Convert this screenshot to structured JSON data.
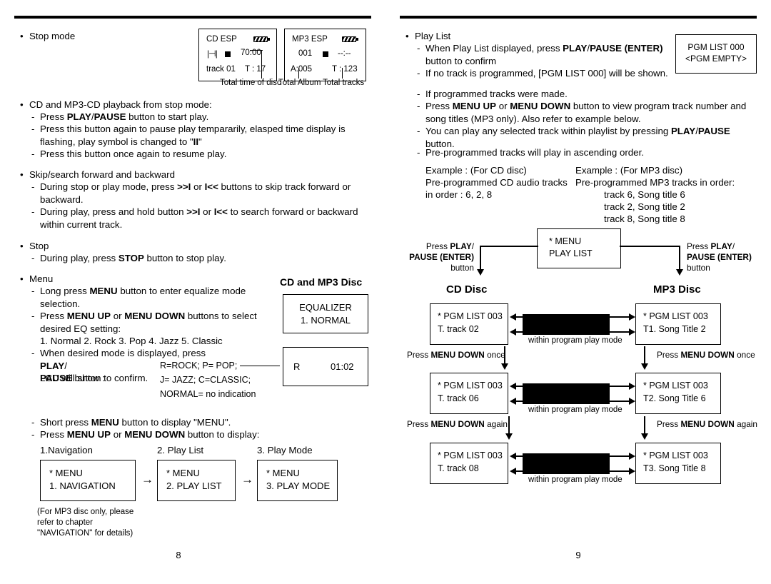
{
  "document": {
    "type": "portable-cd-mp3-player-user-manual-spread",
    "left_page_number": "8",
    "right_page_number": "9"
  },
  "left_page": {
    "stop_mode": {
      "heading": "Stop mode",
      "lcd_cd": {
        "title": "CD ESP",
        "battery_icon": "battery-icon",
        "disc_icon": "disc-icon",
        "stop_icon": "stop-square-icon",
        "time": "70:00",
        "track_label": "track 01",
        "total": "T : 17"
      },
      "lcd_mp3": {
        "title": "MP3 ESP",
        "battery_icon": "battery-icon",
        "number": "001",
        "stop_icon": "stop-square-icon",
        "time": "--:--",
        "album": "A:005",
        "total": "T : 123"
      },
      "captions": {
        "total_time": "Total time of disc",
        "total_album": "Total Album",
        "total_tracks": "Total tracks"
      }
    },
    "playback": {
      "heading": "CD and MP3-CD playback from stop mode:",
      "items": [
        {
          "pre": "Press ",
          "b1": "PLAY",
          "mid": "/",
          "b2": "PAUSE",
          "post": " button to start play."
        },
        {
          "pre": "Press this button again to pause play tempararily, elasped time display is flashing, play symbol is changed to \"",
          "b1": "II",
          "post": "\""
        },
        {
          "pre": "Press this button once again to resume play."
        }
      ]
    },
    "skip": {
      "heading": "Skip/search forward and backward",
      "items": [
        {
          "pre": "During stop or play mode, press ",
          "b1": ">>I",
          "mid": " or ",
          "b2": "I<<",
          "post": " buttons to skip track forward or backward."
        },
        {
          "pre": "During play, press and hold button ",
          "b1": ">>I",
          "mid": " or ",
          "b2": "I<<",
          "post": " to search forward or backward within current track."
        }
      ]
    },
    "stop": {
      "heading": "Stop",
      "item": {
        "pre": "During play, press ",
        "b1": "STOP",
        "post": " button to stop play."
      }
    },
    "menu": {
      "heading": "Menu",
      "items": [
        "Long press MENU button to enter equalize mode selection.",
        "Press MENU UP or MENU DOWN buttons to select desired EQ setting:",
        "1. Normal  2. Rock  3. Pop  4. Jazz  5. Classic",
        "When desired mode is displayed, press PLAY/PAUSE button to confirm.",
        "LCD will show :"
      ],
      "eq_section_title": "CD and MP3 Disc",
      "eq_box": {
        "line1": "EQUALIZER",
        "line2": "1. NORMAL"
      },
      "legend": [
        "R=ROCK; P= POP;",
        "J= JAZZ; C=CLASSIC;",
        "NORMAL= no indication"
      ],
      "eq_lcd": {
        "left": "R",
        "right": "01:02"
      }
    },
    "menu_nav": {
      "items": [
        {
          "pre": "Short press ",
          "b1": "MENU",
          "post": " button to display \"MENU\"."
        },
        {
          "pre": "Press ",
          "b1": "MENU UP",
          "mid": " or ",
          "b2": "MENU DOWN",
          "post": " button to display:"
        }
      ],
      "steps": [
        {
          "label": "1.Navigation",
          "line1": "* MENU",
          "line2": "1. NAVIGATION"
        },
        {
          "label": "2. Play List",
          "line1": "* MENU",
          "line2": "2. PLAY LIST"
        },
        {
          "label": "3. Play Mode",
          "line1": "* MENU",
          "line2": "3. PLAY MODE"
        }
      ],
      "arrow_glyph": "→",
      "footnote": [
        "(For MP3 disc only, please",
        "refer to chapter",
        "\"NAVIGATION\" for details)"
      ]
    }
  },
  "right_page": {
    "play_list": {
      "heading": "Play List",
      "items": [
        {
          "pre": "When Play List displayed, press ",
          "b1": "PLAY",
          "mid": "/",
          "b2": "PAUSE (ENTER)",
          "post": " button to confirm"
        },
        {
          "pre": "If no track is programmed, [PGM LIST 000] will be shown."
        }
      ],
      "pgm_box": {
        "line1": "PGM LIST 000",
        "line2": "<PGM EMPTY>"
      },
      "items2": [
        {
          "pre": "If programmed tracks were made."
        },
        {
          "pre": "Press ",
          "b1": "MENU UP",
          "mid": " or ",
          "b2": "MENU DOWN",
          "post": " button to view program track number and song titles (MP3 only). Also refer to example below."
        },
        {
          "pre": "You can play any selected track within playlist by pressing ",
          "b1": "PLAY",
          "mid": "/",
          "b2": "PAUSE",
          "post": " button."
        }
      ],
      "items3": [
        {
          "pre": "Pre-programmed tracks will play in ascending order."
        }
      ],
      "example_cd": [
        "Example : (For CD disc)",
        "Pre-programmed CD audio tracks",
        "in order : 6, 2, 8"
      ],
      "example_mp3": {
        "lines": [
          "Example : (For MP3 disc)",
          "Pre-programmed MP3 tracks in order:"
        ],
        "tracks": [
          "track 6, Song title 6",
          "track 2, Song title 2",
          "track 8, Song title 8"
        ]
      }
    },
    "flow": {
      "menu_box": {
        "line1": "* MENU",
        "line2": "PLAY LIST"
      },
      "left_label": {
        "l1_pre": "Press ",
        "l1_b": "PLAY",
        "l1_post": "/",
        "l2": "PAUSE (ENTER)",
        "l3": "button"
      },
      "right_label": {
        "l1_pre": "Press ",
        "l1_b": "PLAY",
        "l1_post": "/",
        "l2": "PAUSE (ENTER)",
        "l3": "button"
      },
      "cd_title": "CD  Disc",
      "mp3_title": "MP3 Disc",
      "cd_rows": [
        {
          "line1": "* PGM LIST 003",
          "line2": "T. track 02"
        },
        {
          "line1": "* PGM LIST 003",
          "line2": "T. track 06"
        },
        {
          "line1": "* PGM LIST 003",
          "line2": "T. track 08"
        }
      ],
      "mp3_rows": [
        {
          "line1": "* PGM LIST 003",
          "line2": "T1. Song Title 2"
        },
        {
          "line1": "* PGM LIST 003",
          "line2": "T2. Song Title 6"
        },
        {
          "line1": "* PGM LIST 003",
          "line2": "T3. Song Title 8"
        }
      ],
      "middle_caption": "within program play mode",
      "middle_redacted": "redacted-black-bar",
      "left_steps": [
        {
          "pre": "Press ",
          "b": "MENU DOWN",
          "post": " once"
        },
        {
          "pre": "Press ",
          "b": "MENU DOWN",
          "post": " again"
        }
      ],
      "right_steps": [
        {
          "pre": "Press ",
          "b": "MENU DOWN",
          "post": " once"
        },
        {
          "pre": "Press ",
          "b": "MENU DOWN",
          "post": " again"
        }
      ]
    }
  }
}
